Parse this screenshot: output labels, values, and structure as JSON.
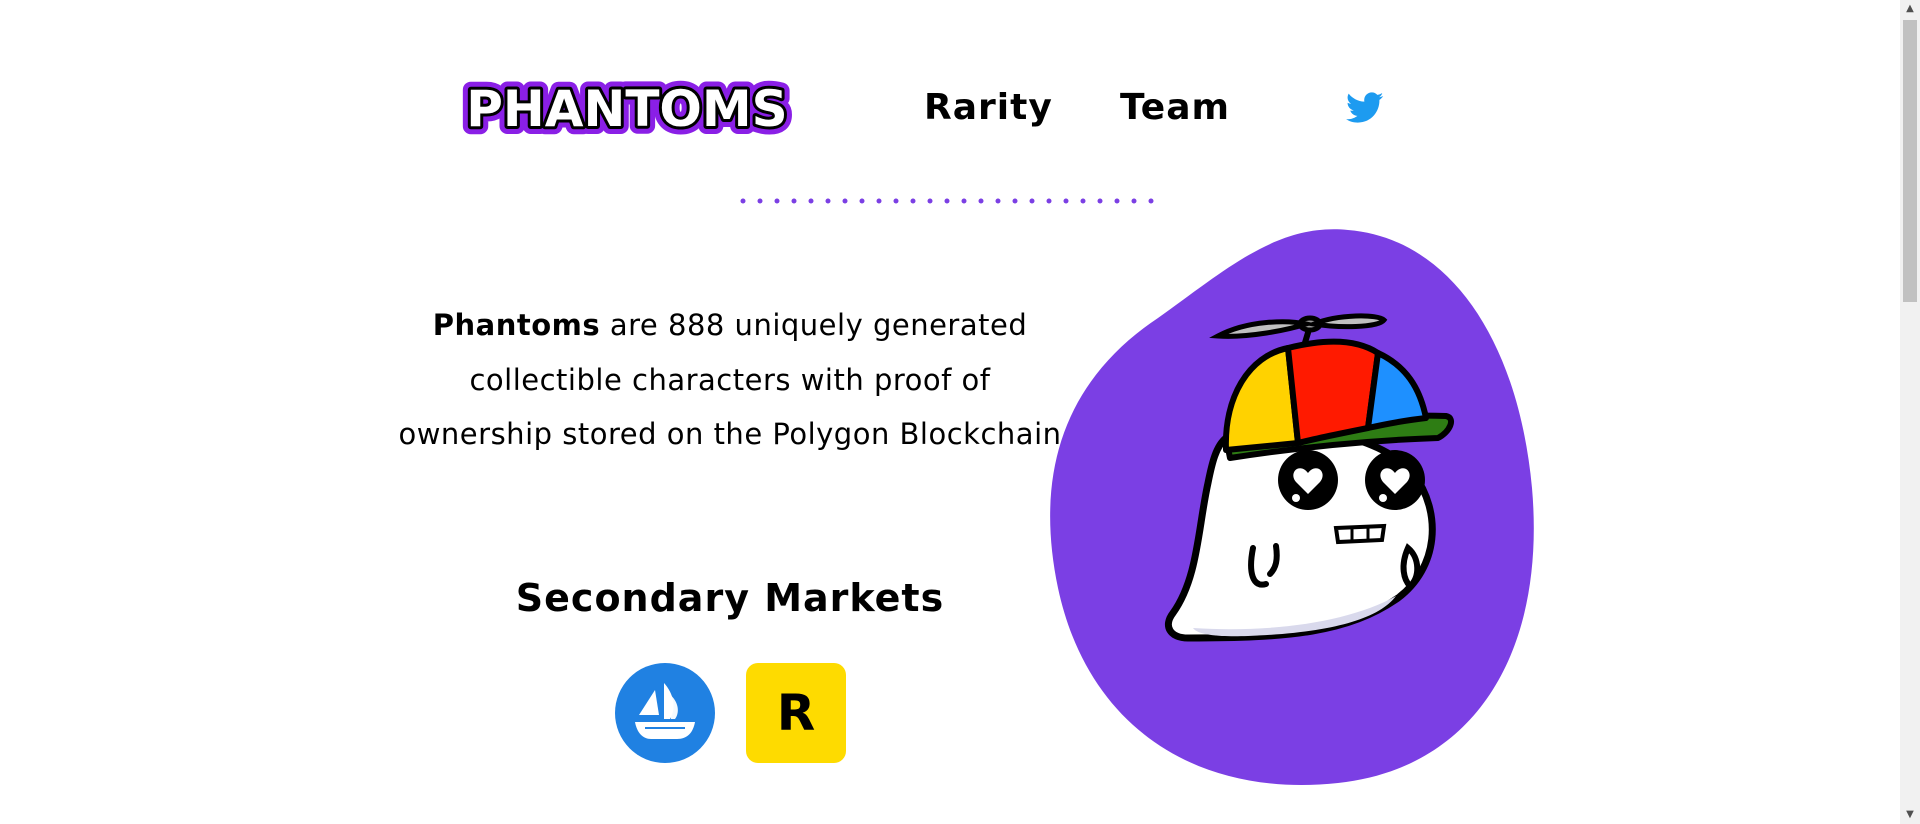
{
  "header": {
    "logo_text": "PHANTOMS",
    "nav": [
      {
        "label": "Rarity"
      },
      {
        "label": "Team"
      }
    ],
    "twitter_icon": "twitter-bird-icon"
  },
  "intro": {
    "brand": "Phantoms",
    "text": " are 888 uniquely generated collectible characters with proof of ownership stored on the Polygon Blockchain"
  },
  "markets": {
    "heading": "Secondary Markets",
    "items": [
      {
        "icon": "opensea-icon",
        "color": "#2081e2"
      },
      {
        "icon": "rarible-icon",
        "color": "#fedb00",
        "letter": "R"
      }
    ]
  },
  "colors": {
    "brand_purple": "#7b3fe4",
    "logo_outline": "#8a1fe6",
    "twitter_blue": "#1d9bf0"
  }
}
